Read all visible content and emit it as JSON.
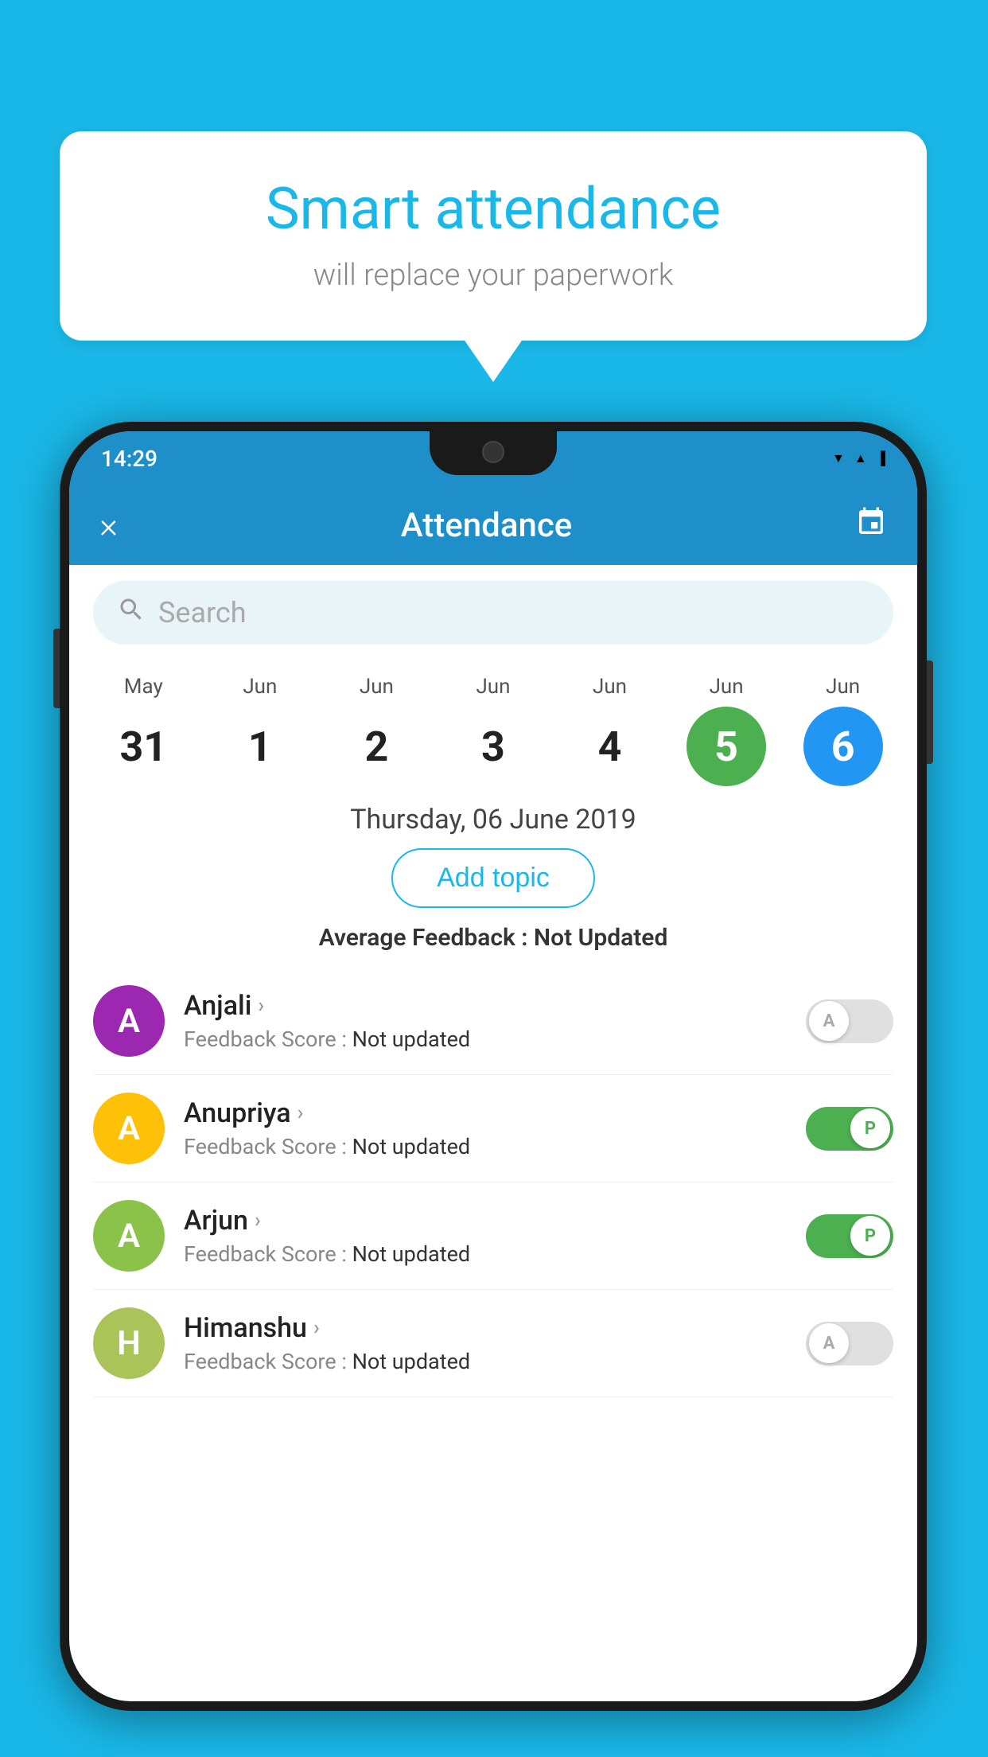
{
  "background_color": "#1ab8e8",
  "bubble": {
    "title": "Smart attendance",
    "subtitle": "will replace your paperwork"
  },
  "status_bar": {
    "time": "14:29",
    "icons": [
      "wifi",
      "signal",
      "battery"
    ]
  },
  "header": {
    "title": "Attendance",
    "close_label": "×",
    "calendar_icon": "📅"
  },
  "search": {
    "placeholder": "Search"
  },
  "calendar": {
    "days": [
      {
        "month": "May",
        "date": "31",
        "state": "normal"
      },
      {
        "month": "Jun",
        "date": "1",
        "state": "normal"
      },
      {
        "month": "Jun",
        "date": "2",
        "state": "normal"
      },
      {
        "month": "Jun",
        "date": "3",
        "state": "normal"
      },
      {
        "month": "Jun",
        "date": "4",
        "state": "normal"
      },
      {
        "month": "Jun",
        "date": "5",
        "state": "green"
      },
      {
        "month": "Jun",
        "date": "6",
        "state": "blue"
      }
    ]
  },
  "selected_date": "Thursday, 06 June 2019",
  "add_topic_label": "Add topic",
  "avg_feedback_label": "Average Feedback :",
  "avg_feedback_value": "Not Updated",
  "students": [
    {
      "name": "Anjali",
      "avatar_letter": "A",
      "avatar_color": "#9c27b0",
      "feedback_label": "Feedback Score :",
      "feedback_value": "Not updated",
      "toggle_state": "off",
      "toggle_letter": "A"
    },
    {
      "name": "Anupriya",
      "avatar_letter": "A",
      "avatar_color": "#ffc107",
      "feedback_label": "Feedback Score :",
      "feedback_value": "Not updated",
      "toggle_state": "on",
      "toggle_letter": "P"
    },
    {
      "name": "Arjun",
      "avatar_letter": "A",
      "avatar_color": "#8bc34a",
      "feedback_label": "Feedback Score :",
      "feedback_value": "Not updated",
      "toggle_state": "on",
      "toggle_letter": "P"
    },
    {
      "name": "Himanshu",
      "avatar_letter": "H",
      "avatar_color": "#aac45a",
      "feedback_label": "Feedback Score :",
      "feedback_value": "Not updated",
      "toggle_state": "off",
      "toggle_letter": "A"
    }
  ]
}
